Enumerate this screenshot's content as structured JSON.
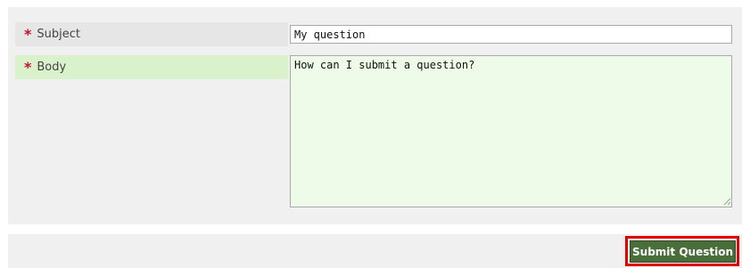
{
  "form": {
    "subject": {
      "label": "Subject",
      "required_marker": "*",
      "value": "My question"
    },
    "body": {
      "label": "Body",
      "required_marker": "*",
      "value": "How can I submit a question?"
    }
  },
  "actions": {
    "submit_label": "Submit Question"
  },
  "colors": {
    "required": "#c8102e",
    "body_label_bg": "#d9f2cc",
    "textarea_bg": "#effbe9",
    "submit_bg": "#4a6e3a",
    "highlight_border": "#e00000"
  }
}
